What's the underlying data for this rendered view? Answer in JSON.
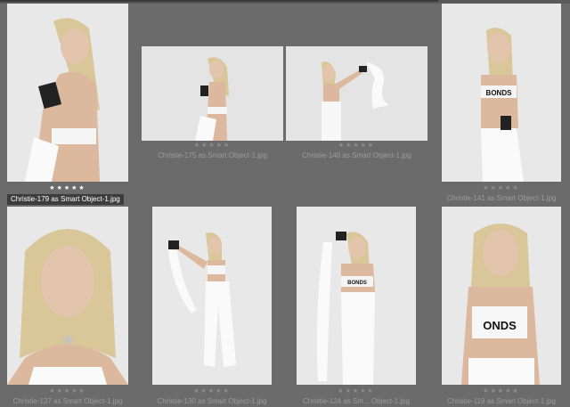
{
  "thumbnails": [
    {
      "file": "Christie-179 as Smart Object-1.jpg",
      "rating": "★★★★★",
      "selected": true
    },
    {
      "file": "Christie-175 as Smart Object-1.jpg",
      "rating": "★★★★★",
      "selected": false
    },
    {
      "file": "Christie-148 as Smart Object-1.jpg",
      "rating": "★★★★★",
      "selected": false
    },
    {
      "file": "Christie-141 as Smart Object-1.jpg",
      "rating": "★★★★★",
      "selected": false
    },
    {
      "file": "Christie-137 as Smart Object-1.jpg",
      "rating": "★★★★★",
      "selected": false
    },
    {
      "file": "Christie-130 as Smart Object-1.jpg",
      "rating": "★★★★★",
      "selected": false
    },
    {
      "file": "Christie-124 as Sm... Object-1.jpg",
      "rating": "★★★★★",
      "selected": false
    },
    {
      "file": "Christie-119 as Smart Object-1.jpg",
      "rating": "★★★★★",
      "selected": false
    }
  ]
}
